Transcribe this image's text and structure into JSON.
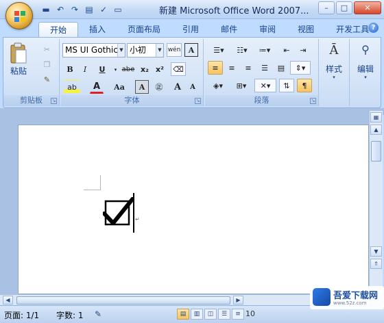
{
  "window": {
    "title": "新建 Microsoft Office Word 2007...",
    "minimize": "–",
    "maximize": "□",
    "close": "✕"
  },
  "quick_access": [
    "save-icon",
    "undo-icon",
    "redo-icon",
    "print-preview-icon",
    "spell-icon",
    "open-icon"
  ],
  "tabs": [
    {
      "label": "开始",
      "active": true
    },
    {
      "label": "插入",
      "active": false
    },
    {
      "label": "页面布局",
      "active": false
    },
    {
      "label": "引用",
      "active": false
    },
    {
      "label": "邮件",
      "active": false
    },
    {
      "label": "审阅",
      "active": false
    },
    {
      "label": "视图",
      "active": false
    },
    {
      "label": "开发工具",
      "active": false
    }
  ],
  "ribbon": {
    "clipboard": {
      "paste_label": "粘贴",
      "group_label": "剪贴板"
    },
    "font": {
      "font_name": "MS UI Gothic",
      "font_size": "小初",
      "wen": "wén",
      "group_label": "字体",
      "bold": "B",
      "italic": "I",
      "underline": "U",
      "strike": "abe",
      "subscript": "x₂",
      "superscript": "x²",
      "highlight": "ab",
      "font_color": "A",
      "change_case": "Aa",
      "grow": "A",
      "shrink": "A"
    },
    "paragraph": {
      "group_label": "段落"
    },
    "styles": {
      "label": "样式"
    },
    "editing": {
      "label": "编辑"
    }
  },
  "document": {
    "symbol": "☑"
  },
  "statusbar": {
    "page": "页面: 1/1",
    "words": "字数: 1",
    "zoom": "10"
  },
  "watermark": {
    "text": "吾爱下载网",
    "sub": "www.52z.com"
  },
  "colors": {
    "ribbon_bg": "#d5e4f7",
    "accent": "#15428b",
    "selected": "#f7c35f"
  }
}
